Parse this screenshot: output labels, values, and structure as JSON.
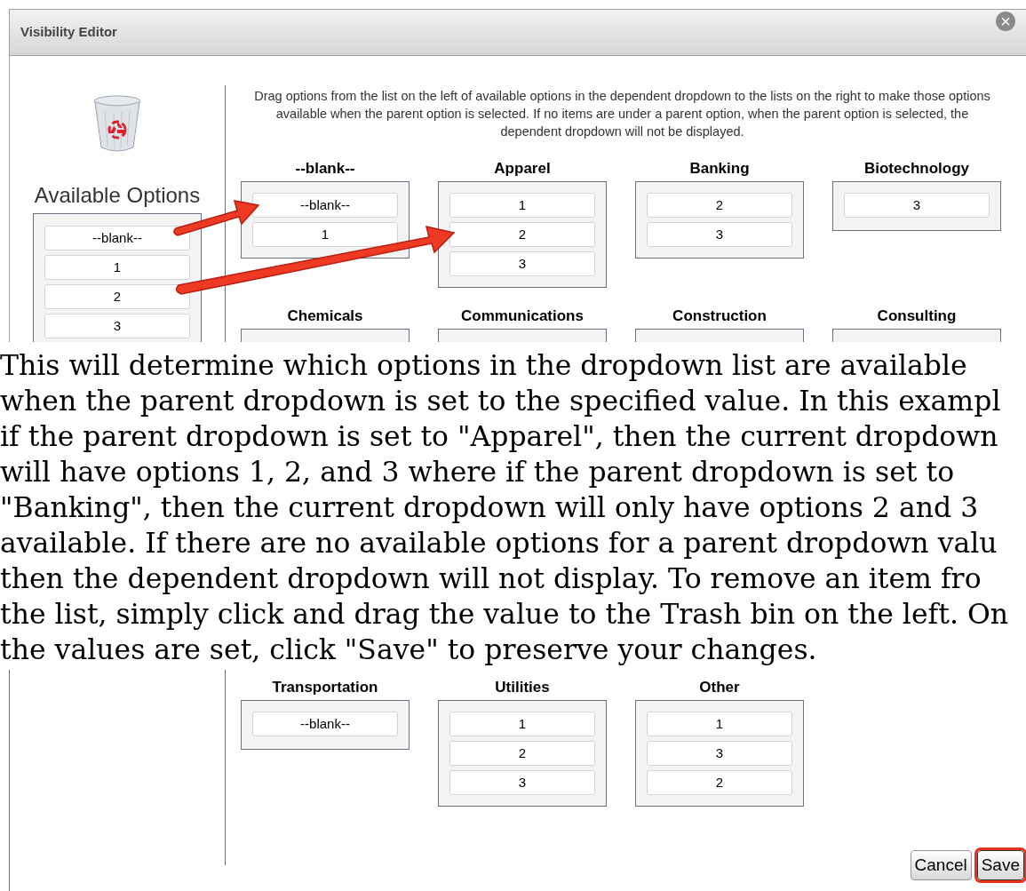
{
  "editor_top": {
    "title": "Visibility Editor",
    "close": "×",
    "available_options": {
      "title": "Available Options",
      "items": [
        "--blank--",
        "1",
        "2",
        "3"
      ]
    },
    "instructions": "Drag options from the list on the left of available options in the dependent dropdown to the lists on the right to make those options available when the parent option is selected. If no items are under a parent option, when the parent option is selected, the dependent dropdown will not be displayed.",
    "groups": [
      {
        "name": "--blank--",
        "items": [
          "--blank--",
          "1"
        ]
      },
      {
        "name": "Apparel",
        "items": [
          "1",
          "2",
          "3"
        ]
      },
      {
        "name": "Banking",
        "items": [
          "2",
          "3"
        ]
      },
      {
        "name": "Biotechnology",
        "items": [
          "3"
        ]
      },
      {
        "name": "Chemicals"
      },
      {
        "name": "Communications"
      },
      {
        "name": "Construction"
      },
      {
        "name": "Consulting"
      }
    ]
  },
  "paragraph_lines": [
    "This will determine which options in the dropdown list are available",
    "when the parent dropdown is set to the specified value. In this exampl",
    "if the parent dropdown is set to \"Apparel\", then the current dropdown",
    "will have options 1, 2, and 3 where if the parent dropdown is set to",
    "\"Banking\", then the current dropdown will only have options 2 and 3",
    "available. If there are no available options for a parent dropdown valu",
    "then the dependent dropdown will not display. To remove an item fro",
    "the list, simply click and drag the value to the Trash bin on the left. On",
    "the values are set, click \"Save\" to preserve your changes."
  ],
  "editor_bottom": {
    "groups": [
      {
        "name": "Transportation",
        "items": [
          "--blank--"
        ]
      },
      {
        "name": "Utilities",
        "items": [
          "1",
          "2",
          "3"
        ]
      },
      {
        "name": "Other",
        "items": [
          "1",
          "3",
          "2"
        ]
      }
    ],
    "buttons": [
      {
        "label": "Cancel",
        "highlighted": false
      },
      {
        "label": "Save",
        "highlighted": true
      }
    ]
  }
}
